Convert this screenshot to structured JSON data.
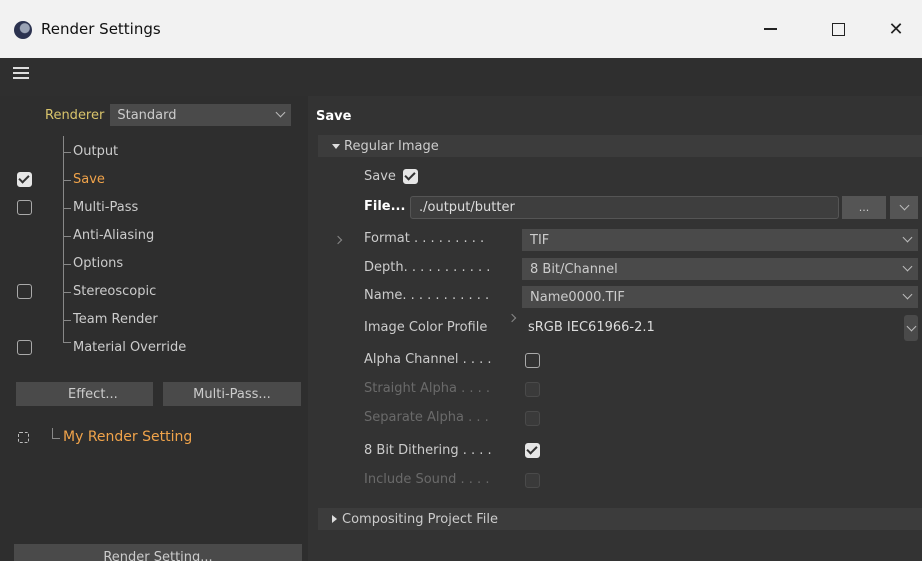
{
  "window": {
    "title": "Render Settings",
    "minimize_label": "",
    "maximize_label": "",
    "close_label": "✕"
  },
  "sidebar": {
    "renderer_label": "Renderer",
    "renderer_value": "Standard",
    "items": [
      {
        "label": "Output",
        "checkbox": "none",
        "active": false
      },
      {
        "label": "Save",
        "checkbox": "checked",
        "active": true
      },
      {
        "label": "Multi-Pass",
        "checkbox": "unchecked",
        "active": false
      },
      {
        "label": "Anti-Aliasing",
        "checkbox": "none",
        "active": false
      },
      {
        "label": "Options",
        "checkbox": "none",
        "active": false
      },
      {
        "label": "Stereoscopic",
        "checkbox": "unchecked",
        "active": false
      },
      {
        "label": "Team Render",
        "checkbox": "none",
        "active": false
      },
      {
        "label": "Material Override",
        "checkbox": "unchecked",
        "active": false
      }
    ],
    "effect_button": "Effect...",
    "multipass_button": "Multi-Pass...",
    "render_setting_name": "My Render Setting",
    "render_setting_button": "Render Setting..."
  },
  "main": {
    "section_title": "Save",
    "regular_image": {
      "header": "Regular Image",
      "save_label": "Save",
      "save_checked": true,
      "file_label": "File...",
      "file_value": "./output/butter",
      "file_more_button": "...",
      "format_label": "Format . . . . . . . . .",
      "format_value": "TIF",
      "depth_label": "Depth. . . . . . . . . . .",
      "depth_value": "8 Bit/Channel",
      "name_label": "Name. . . . . . . . . . .",
      "name_value": "Name0000.TIF",
      "color_profile_label": "Image Color Profile",
      "color_profile_value": "sRGB IEC61966-2.1",
      "alpha_channel_label": "Alpha Channel . . . .",
      "alpha_channel_checked": false,
      "straight_alpha_label": "Straight Alpha . . . .",
      "separate_alpha_label": "Separate Alpha . . .",
      "dithering_label": "8 Bit Dithering . . . .",
      "dithering_checked": true,
      "include_sound_label": "Include Sound . . . ."
    },
    "compositing": {
      "header": "Compositing Project File"
    }
  },
  "colors": {
    "accent_orange": "#f0a34a",
    "renderer_label": "#d9c46b",
    "panel_bg": "#2e2e2e",
    "main_bg": "#333333"
  }
}
